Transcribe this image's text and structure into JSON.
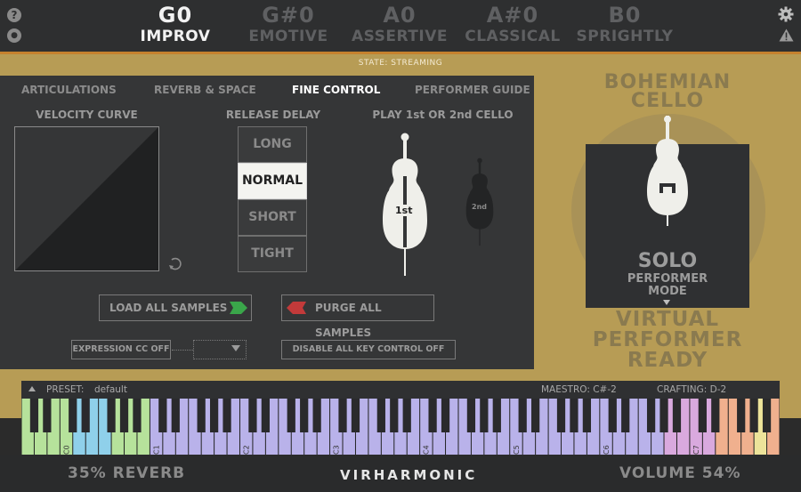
{
  "header": {
    "keys": [
      {
        "note": "G0",
        "style": "IMPROV",
        "active": true
      },
      {
        "note": "G#0",
        "style": "EMOTIVE",
        "active": false
      },
      {
        "note": "A0",
        "style": "ASSERTIVE",
        "active": false
      },
      {
        "note": "A#0",
        "style": "CLASSICAL",
        "active": false
      },
      {
        "note": "B0",
        "style": "SPRIGHTLY",
        "active": false
      }
    ],
    "left_icons": [
      "help-icon",
      "palette-icon"
    ],
    "right_icons": [
      "gear-icon",
      "warning-icon"
    ]
  },
  "state_text": "STATE: STREAMING",
  "tabs": [
    "ARTICULATIONS",
    "REVERB & SPACE",
    "FINE CONTROL",
    "PERFORMER GUIDE"
  ],
  "active_tab": "FINE CONTROL",
  "fine_control": {
    "velocity_curve_label": "VELOCITY CURVE",
    "release_delay_label": "RELEASE DELAY",
    "release_options": [
      "LONG",
      "NORMAL",
      "SHORT",
      "TIGHT"
    ],
    "release_selected": "NORMAL",
    "cello_choice_label": "PLAY 1st OR 2nd CELLO",
    "cello_1_label": "1st",
    "cello_2_label": "2nd",
    "load_samples": "LOAD ALL SAMPLES",
    "purge_samples": "PURGE ALL SAMPLES",
    "expression_cc": "EXPRESSION CC OFF",
    "disable_key_control": "DISABLE ALL KEY CONTROL OFF"
  },
  "instrument": {
    "name_line1": "BOHEMIAN",
    "name_line2": "CELLO",
    "mode": "SOLO",
    "mode_label_line1": "PERFORMER",
    "mode_label_line2": "MODE",
    "status_line1": "VIRTUAL",
    "status_line2": "PERFORMER",
    "status_line3": "READY"
  },
  "keyboard": {
    "preset_label": "PRESET:",
    "preset_value": "default",
    "maestro": "MAESTRO: C#-2",
    "crafting": "CRAFTING: D-2",
    "octave_labels": [
      "C0",
      "C1",
      "C2",
      "C3",
      "C4",
      "C5",
      "C6",
      "C7"
    ]
  },
  "footer": {
    "reverb": "35% REVERB",
    "brand": "VIRHARMONIC",
    "volume": "VOLUME 54%"
  },
  "colors": {
    "gold": "#b79c55",
    "panel": "#353637",
    "accent_orange": "#c5822e",
    "key_green": "#b6e29b",
    "key_blue": "#8fd0ea",
    "key_purple": "#b9b2ea",
    "key_lilac": "#d9a9de",
    "key_orange": "#f0b08e",
    "key_yellow": "#ece39a"
  }
}
